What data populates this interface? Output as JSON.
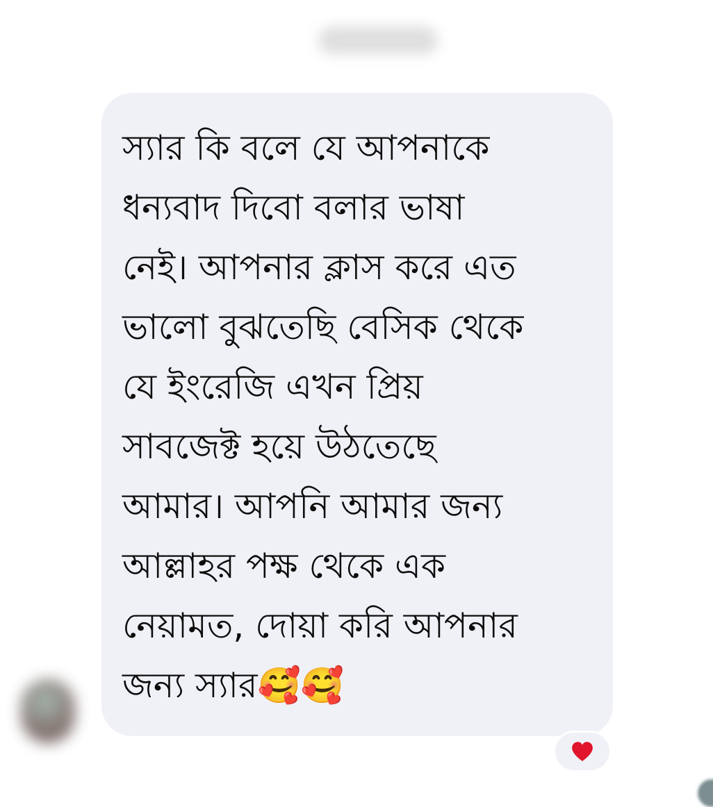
{
  "message": {
    "lines": [
      "স্যার কি বলে যে আপনাকে",
      "ধন্যবাদ দিবো বলার ভাষা",
      "নেই।  আপনার ক্লাস করে এত",
      "ভালো বুঝতেছি বেসিক থেকে",
      "যে ইংরেজি এখন প্রিয়",
      "সাবজেক্ট হয়ে উঠতেছে",
      "আমার। আপনি আমার জন্য",
      "আল্লাহর পক্ষ থেকে এক",
      "নেয়ামত, দোয়া করি আপনার",
      "জন্য স্যার🥰🥰"
    ]
  },
  "reaction": {
    "icon": "heart-icon",
    "color": "#e0142b"
  },
  "colors": {
    "bubble": "#f0f1f6",
    "text": "#0c0c0c",
    "background": "#ffffff"
  }
}
